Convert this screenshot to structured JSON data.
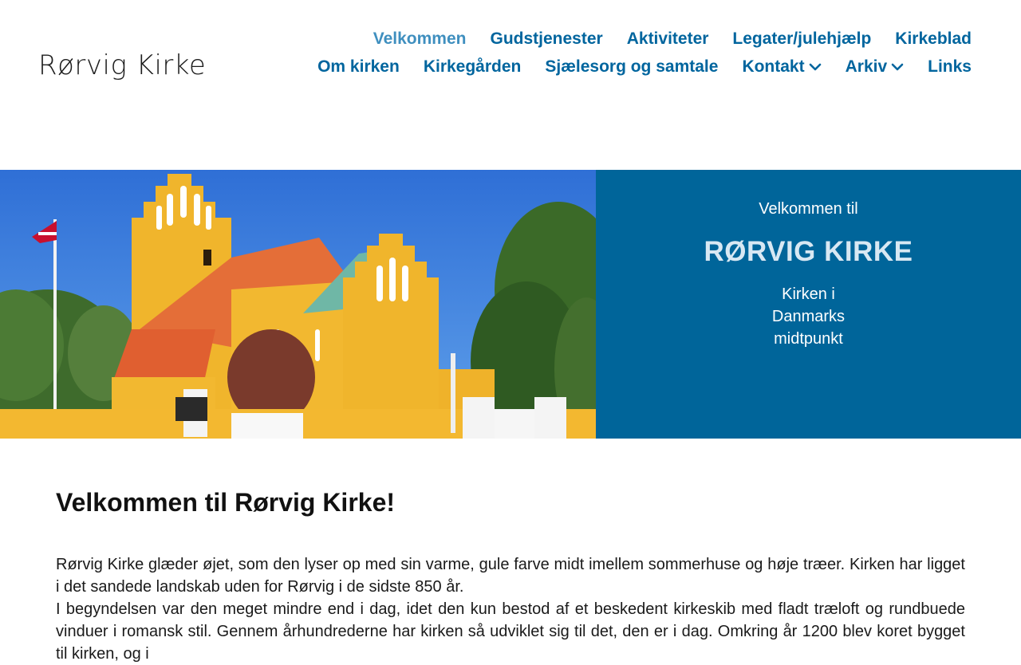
{
  "header": {
    "logo_text": "Rørvig Kirke"
  },
  "nav": {
    "row1": [
      {
        "label": "Velkommen",
        "active": true
      },
      {
        "label": "Gudstjenester"
      },
      {
        "label": "Aktiviteter"
      },
      {
        "label": "Legater/julehjælp"
      },
      {
        "label": "Kirkeblad"
      }
    ],
    "row2": [
      {
        "label": "Om kirken"
      },
      {
        "label": "Kirkegården"
      },
      {
        "label": "Sjælesorg og samtale"
      },
      {
        "label": "Kontakt",
        "has_dropdown": true
      },
      {
        "label": "Arkiv",
        "has_dropdown": true
      },
      {
        "label": "Links"
      }
    ]
  },
  "hero": {
    "pretitle": "Velkommen til",
    "title": "RØRVIG KIRKE",
    "tagline": "Kirken i Danmarks midtpunkt"
  },
  "content": {
    "heading": "Velkommen til Rørvig Kirke!",
    "paragraphs": [
      "Rørvig Kirke glæder øjet, som den lyser op med sin varme, gule farve midt imellem sommerhuse og høje træer. Kirken har ligget i det sandede landskab uden for Rørvig i de sidste 850 år.",
      "I begyndelsen var den meget mindre end i dag, idet den kun bestod af et beskedent kirkeskib med fladt træloft og rundbuede vinduer i romansk stil. Gennem århundrederne har kirken så udviklet sig til det, den er i dag. Omkring år 1200 blev koret bygget til kirken, og i"
    ]
  },
  "colors": {
    "nav": "#00659e",
    "nav_active": "#3f8fbf",
    "hero_panel": "#00659a"
  }
}
